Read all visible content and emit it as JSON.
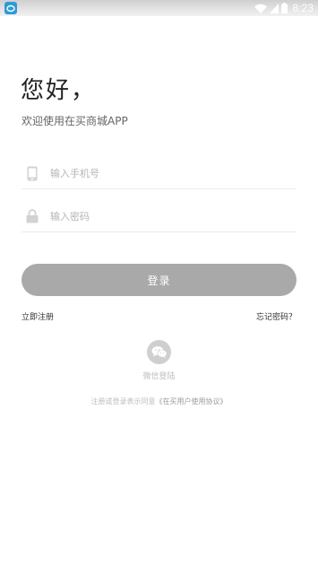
{
  "status_bar": {
    "time": "8:23",
    "icons": [
      "app-notification-icon",
      "wifi-icon",
      "signal-icon",
      "battery-icon"
    ]
  },
  "login": {
    "greeting": "您好，",
    "welcome": "欢迎使用在买商城APP",
    "phone_placeholder": "输入手机号",
    "password_placeholder": "输入密码",
    "login_button": "登录",
    "register_link": "立即注册",
    "forgot_link": "忘记密码？",
    "wechat_label": "微信登陆",
    "agreement_prefix": "注册或登录表示同意",
    "agreement_link": "《在买用户使用协议》"
  },
  "colors": {
    "button_gray": "#a9a9a9",
    "accent_blue": "#2f9bd6"
  }
}
